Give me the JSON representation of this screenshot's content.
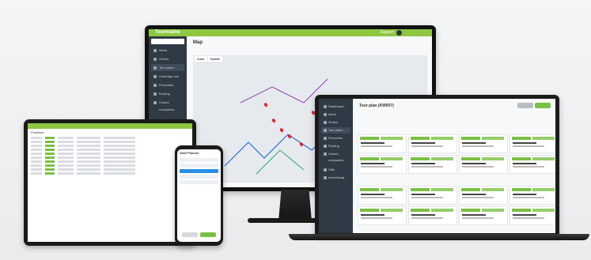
{
  "monitor": {
    "brand": "Tourmaline",
    "support_label": "Support",
    "page_title": "Map",
    "map_tabs": [
      "Karte",
      "Satellit"
    ],
    "sidebar_items": [
      "Alerts",
      "Orders",
      "Tour plans",
      "Coverage tool",
      "Promotion",
      "Routing",
      "Closed companies"
    ]
  },
  "tablet": {
    "heading": "Positions"
  },
  "phone": {
    "title": "Shift Planner"
  },
  "laptop": {
    "title": "Tour plan (KW007)",
    "sidebar_items": [
      "Dashboard",
      "Alerts",
      "Orders",
      "Tour plans",
      "Promotion",
      "Routing",
      "Closed companies",
      "Hilfe",
      "Abmeldung"
    ]
  }
}
